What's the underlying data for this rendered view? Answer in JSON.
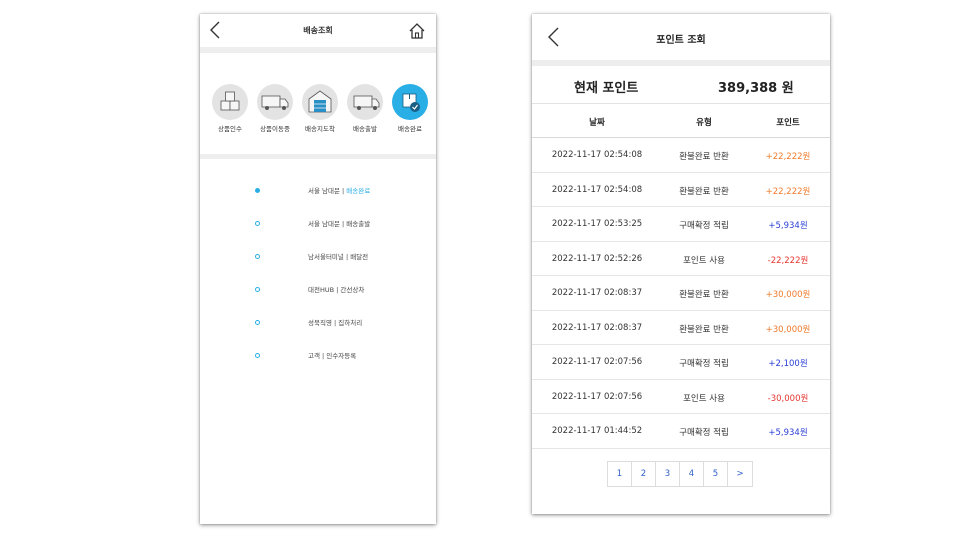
{
  "left_screen": {
    "title": "배송조회",
    "back_icon": "chevron-left-icon",
    "home_icon": "home-icon",
    "accent": "#29aee6",
    "steps": [
      {
        "label": "상품인수",
        "icon": "boxes-icon",
        "active": false
      },
      {
        "label": "상품이동중",
        "icon": "truck-moving-icon",
        "active": false
      },
      {
        "label": "배송지도착",
        "icon": "warehouse-icon",
        "active": false
      },
      {
        "label": "배송출발",
        "icon": "truck-departing-icon",
        "active": false
      },
      {
        "label": "배송완료",
        "icon": "box-check-icon",
        "active": true
      }
    ],
    "timeline": [
      {
        "location": "서울 남대문",
        "status": "배송완료",
        "active": true
      },
      {
        "location": "서울 남대문",
        "status": "배송출발",
        "active": false
      },
      {
        "location": "남서울터미널",
        "status": "배달전",
        "active": false
      },
      {
        "location": "대전HUB",
        "status": "간선상차",
        "active": false
      },
      {
        "location": "성북직영",
        "status": "집하처리",
        "active": false
      },
      {
        "location": "고객",
        "status": "인수자등록",
        "active": false
      }
    ]
  },
  "right_screen": {
    "title": "포인트 조회",
    "back_icon": "chevron-left-icon",
    "current_label": "현재 포인트",
    "current_value": "389,388 원",
    "columns": [
      "날짜",
      "유형",
      "포인트"
    ],
    "colors": {
      "plus_refund": "#f07a2a",
      "plus_confirm": "#2a3fd6",
      "minus": "#e5352e"
    },
    "rows": [
      {
        "date": "2022-11-17 02:54:08",
        "type": "환불완료 반환",
        "points": "+22,222원",
        "kind": "plus_refund"
      },
      {
        "date": "2022-11-17 02:54:08",
        "type": "환불완료 반환",
        "points": "+22,222원",
        "kind": "plus_refund"
      },
      {
        "date": "2022-11-17 02:53:25",
        "type": "구매확정 적립",
        "points": "+5,934원",
        "kind": "plus_confirm"
      },
      {
        "date": "2022-11-17 02:52:26",
        "type": "포인트 사용",
        "points": "-22,222원",
        "kind": "minus"
      },
      {
        "date": "2022-11-17 02:08:37",
        "type": "환불완료 반환",
        "points": "+30,000원",
        "kind": "plus_refund"
      },
      {
        "date": "2022-11-17 02:08:37",
        "type": "환불완료 반환",
        "points": "+30,000원",
        "kind": "plus_refund"
      },
      {
        "date": "2022-11-17 02:07:56",
        "type": "구매확정 적립",
        "points": "+2,100원",
        "kind": "plus_confirm"
      },
      {
        "date": "2022-11-17 02:07:56",
        "type": "포인트 사용",
        "points": "-30,000원",
        "kind": "minus"
      },
      {
        "date": "2022-11-17 01:44:52",
        "type": "구매확정 적립",
        "points": "+5,934원",
        "kind": "plus_confirm"
      }
    ],
    "pagination": [
      "1",
      "2",
      "3",
      "4",
      "5",
      ">"
    ]
  }
}
